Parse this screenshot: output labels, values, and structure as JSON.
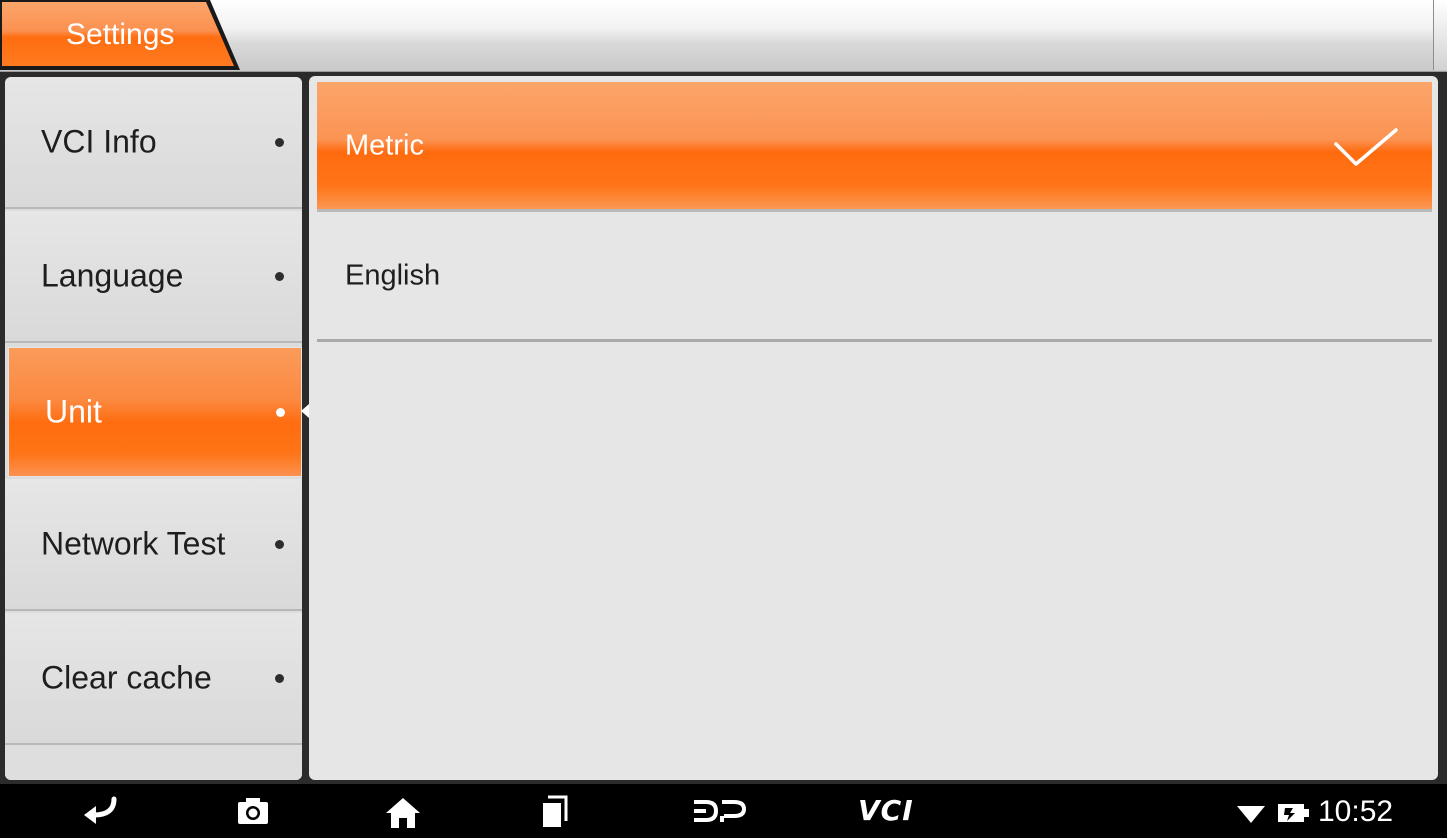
{
  "header": {
    "title": "Settings"
  },
  "menu": {
    "items": [
      {
        "label": "VCI Info",
        "active": false
      },
      {
        "label": "Language",
        "active": false
      },
      {
        "label": "Unit",
        "active": true
      },
      {
        "label": "Network Test",
        "active": false
      },
      {
        "label": "Clear cache",
        "active": false
      }
    ]
  },
  "unit_options": [
    {
      "label": "Metric",
      "selected": true
    },
    {
      "label": "English",
      "selected": false
    }
  ],
  "navbar": {
    "vci_label": "VCI",
    "clock": "10:52",
    "icons": [
      "back-icon",
      "screenshot-icon",
      "home-icon",
      "recent-apps-icon",
      "dp-icon",
      "vci-icon",
      "wifi-icon",
      "battery-charging-icon"
    ]
  },
  "colors": {
    "accent": "#ff7416",
    "accent_light": "#fb9b5a",
    "panel_bg": "#e6e6e6",
    "navbar_bg": "#000000"
  }
}
